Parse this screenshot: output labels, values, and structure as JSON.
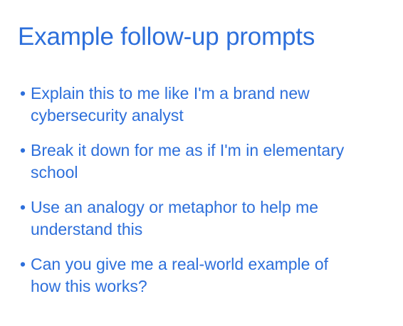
{
  "slide": {
    "title": "Example follow-up prompts",
    "bullet_symbol": "•",
    "items": [
      {
        "text": "Explain this to me like I'm a brand new cybersecurity analyst"
      },
      {
        "text": "Break it down for me as if I'm in elementary school"
      },
      {
        "text": "Use an analogy or metaphor to help me understand this"
      },
      {
        "text": "Can you give me a real-world example of how this works?"
      }
    ]
  },
  "colors": {
    "text": "#2d6fdb",
    "background": "#ffffff"
  }
}
